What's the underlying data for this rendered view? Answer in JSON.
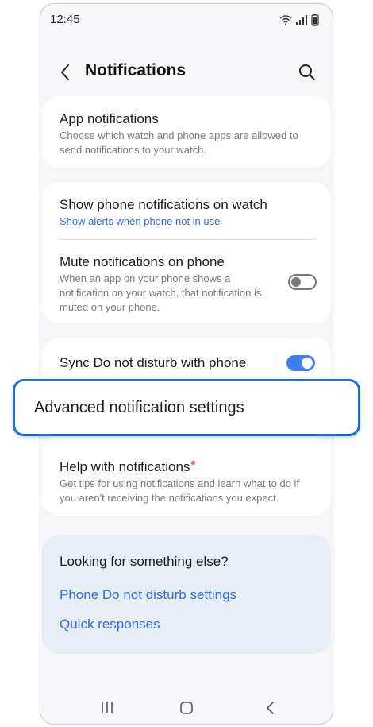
{
  "status_bar": {
    "time": "12:45",
    "icons": [
      "wifi-icon",
      "signal-icon",
      "battery-icon"
    ]
  },
  "header": {
    "title": "Notifications",
    "back_icon": "chevron-left-icon",
    "search_icon": "search-icon"
  },
  "app_notifications": {
    "title": "App notifications",
    "description": "Choose which watch and phone apps are allowed to send notifications to your watch."
  },
  "show_phone_notifications": {
    "title": "Show phone notifications on watch",
    "value": "Show alerts when phone not in use"
  },
  "mute_notifications": {
    "title": "Mute notifications on phone",
    "description": "When an app on your phone shows a notification on your watch, that notification is muted on your phone.",
    "enabled": false
  },
  "sync_dnd": {
    "title": "Sync Do not disturb with phone",
    "enabled": true
  },
  "advanced": {
    "title": "Advanced notification settings"
  },
  "help": {
    "title": "Help with notifications",
    "description": "Get tips for using notifications and learn what to do if you aren't receiving the notifications you expect."
  },
  "suggestions": {
    "title": "Looking for something else?",
    "links": [
      "Phone Do not disturb settings",
      "Quick responses"
    ]
  },
  "nav": {
    "icons": [
      "recents-icon",
      "home-icon",
      "back-icon"
    ]
  },
  "colors": {
    "accent": "#3e7ff0",
    "link": "#2f6fd6",
    "highlight": "#1e6fd9",
    "badge": "#f2622e"
  }
}
